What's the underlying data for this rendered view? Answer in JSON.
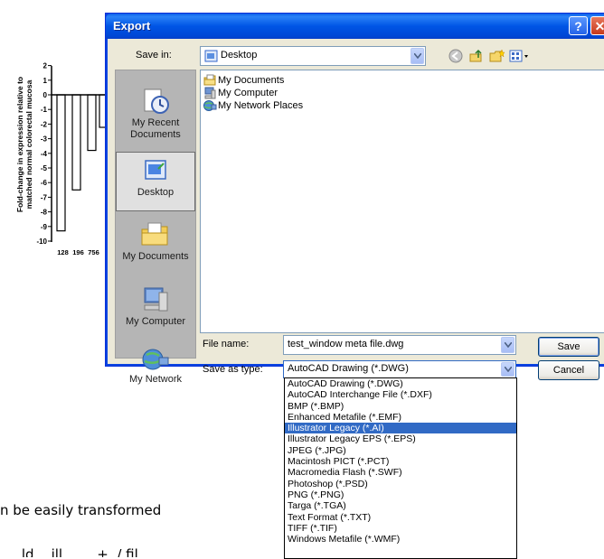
{
  "background": {
    "chart": {
      "ylabel_line1": "Fold-change in expression relative to",
      "ylabel_line2": "matched normal colorectal mucosa",
      "yticks": [
        "2",
        "1",
        "0",
        "-1",
        "-2",
        "-3",
        "-4",
        "-5",
        "-6",
        "-7",
        "-8",
        "-9",
        "-10"
      ],
      "xticks": [
        "128",
        "196",
        "756"
      ],
      "chart_data": {
        "type": "bar",
        "categories": [
          "128",
          "196",
          "756"
        ],
        "values": [
          -9.3,
          -6.5,
          -3.8
        ],
        "ylabel": "Fold-change in expression relative to matched normal colorectal mucosa",
        "ylim": [
          -10,
          2
        ]
      }
    },
    "text_line1": "n be easily transformed",
    "text_line2": "... .ld ...ill ... ...+ ./ fil"
  },
  "dialog": {
    "title": "Export",
    "help_glyph": "?",
    "close_glyph": "✕",
    "save_in_label": "Save in:",
    "save_in_value": "Desktop",
    "places": [
      {
        "label1": "My Recent",
        "label2": "Documents"
      },
      {
        "label1": "Desktop",
        "label2": ""
      },
      {
        "label1": "My Documents",
        "label2": ""
      },
      {
        "label1": "My Computer",
        "label2": ""
      },
      {
        "label1": "My Network",
        "label2": ""
      }
    ],
    "files": [
      "My Documents",
      "My Computer",
      "My Network Places"
    ],
    "file_name_label": "File name:",
    "file_name_value": "test_window meta file.dwg",
    "save_as_label": "Save as type:",
    "save_as_value": "AutoCAD Drawing (*.DWG)",
    "save_button": "Save",
    "cancel_button": "Cancel"
  },
  "dropdown": {
    "options": [
      "AutoCAD Drawing (*.DWG)",
      "AutoCAD Interchange File (*.DXF)",
      "BMP (*.BMP)",
      "Enhanced Metafile (*.EMF)",
      "Illustrator Legacy (*.AI)",
      "Illustrator Legacy EPS (*.EPS)",
      "JPEG (*.JPG)",
      "Macintosh PICT (*.PCT)",
      "Macromedia Flash (*.SWF)",
      "Photoshop (*.PSD)",
      "PNG (*.PNG)",
      "Targa (*.TGA)",
      "Text Format (*.TXT)",
      "TIFF (*.TIF)",
      "Windows Metafile (*.WMF)"
    ],
    "highlighted_index": 4,
    "highlight_color": "#316ac5"
  }
}
